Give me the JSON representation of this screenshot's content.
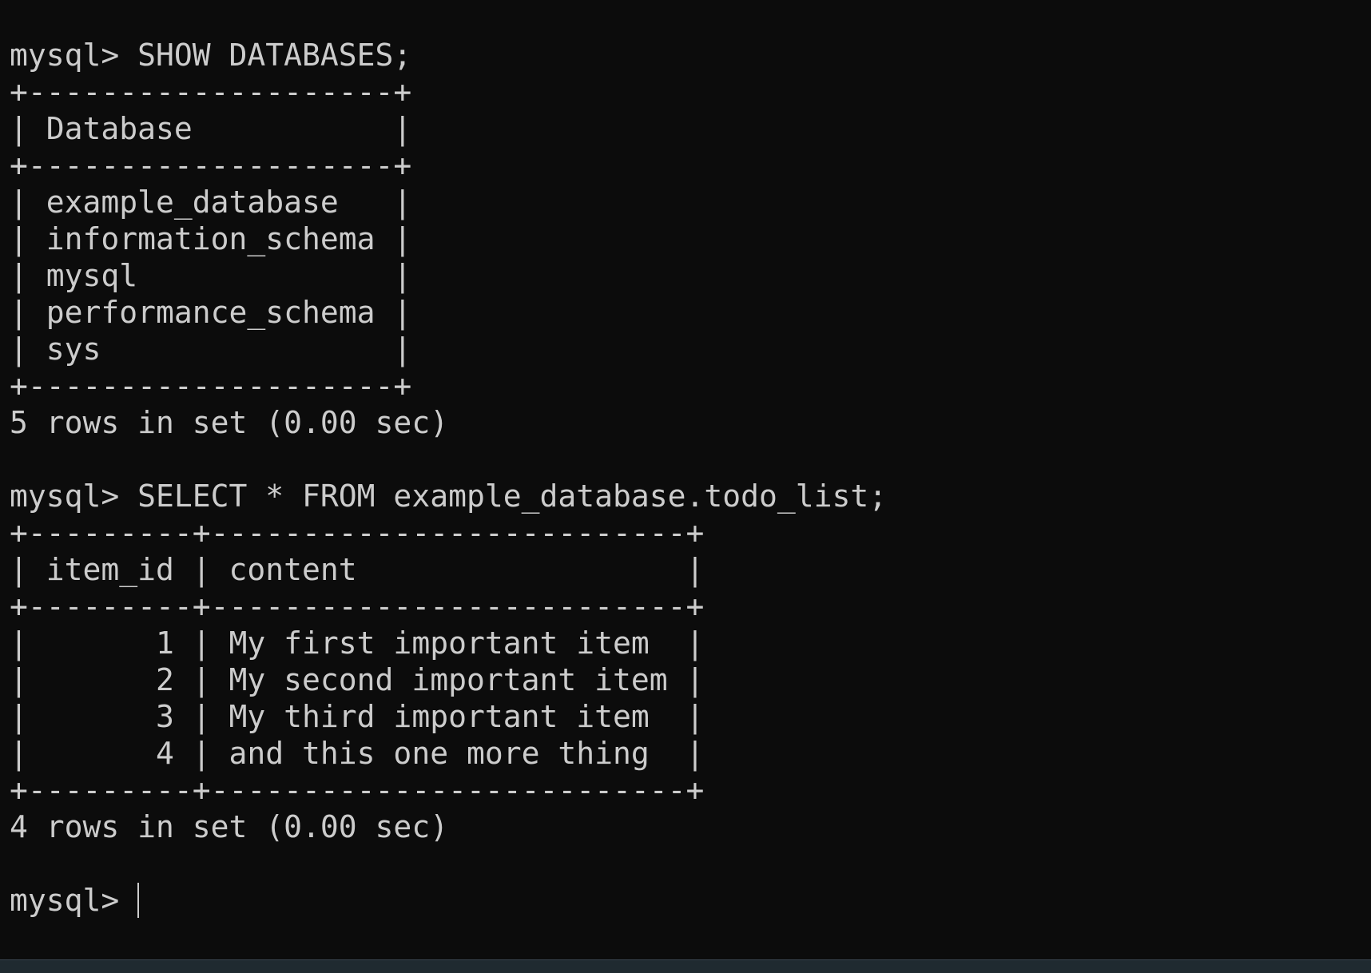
{
  "terminal": {
    "lines": [
      "mysql> SHOW DATABASES;",
      "+--------------------+",
      "| Database           |",
      "+--------------------+",
      "| example_database   |",
      "| information_schema |",
      "| mysql              |",
      "| performance_schema |",
      "| sys                |",
      "+--------------------+",
      "5 rows in set (0.00 sec)",
      "",
      "mysql> SELECT * FROM example_database.todo_list;",
      "+---------+--------------------------+",
      "| item_id | content                  |",
      "+---------+--------------------------+",
      "|       1 | My first important item  |",
      "|       2 | My second important item |",
      "|       3 | My third important item  |",
      "|       4 | and this one more thing  |",
      "+---------+--------------------------+",
      "4 rows in set (0.00 sec)",
      ""
    ],
    "prompt": "mysql> "
  },
  "colors": {
    "background": "#0c0c0c",
    "foreground": "#cccccc"
  }
}
